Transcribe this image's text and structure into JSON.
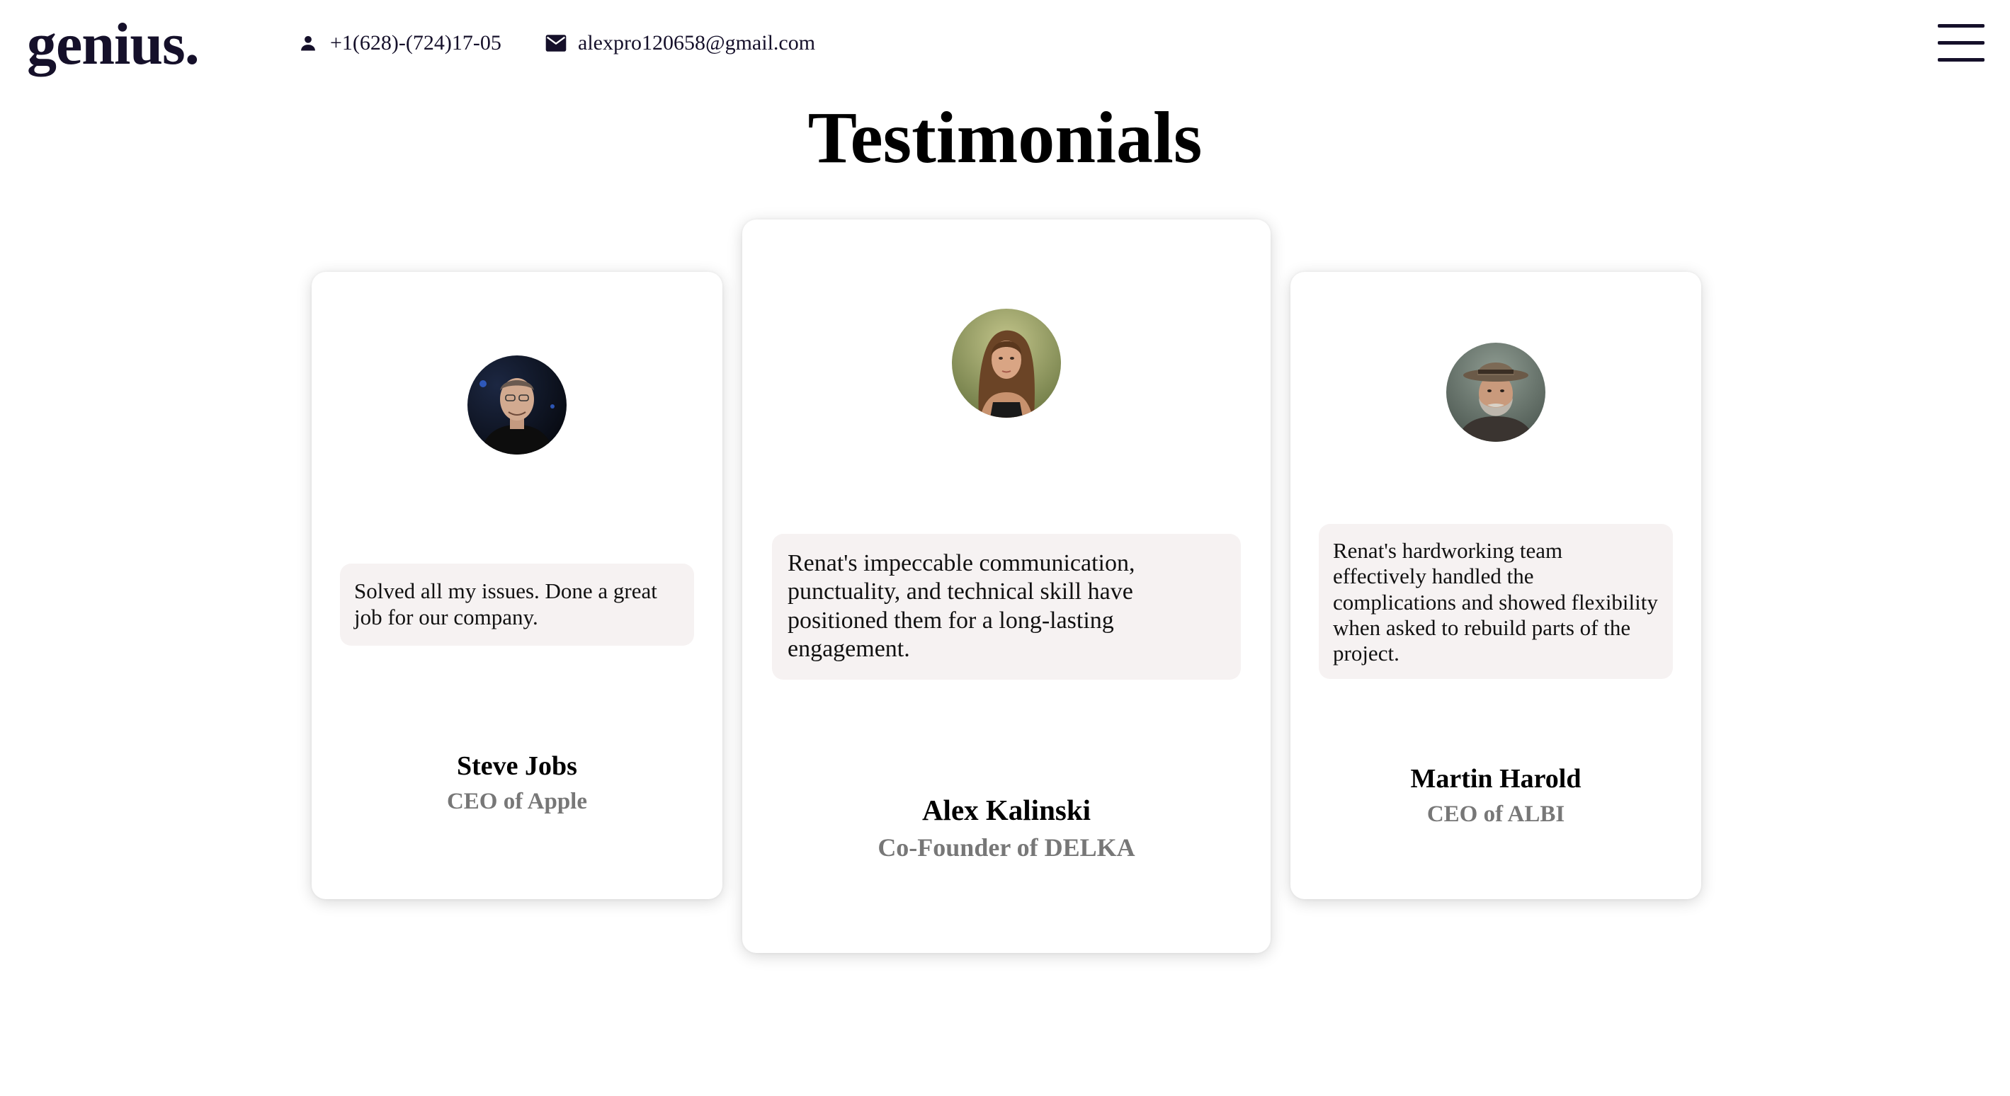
{
  "header": {
    "logo": "genius.",
    "phone": "+1(628)-(724)17-05",
    "email": "alexpro120658@gmail.com",
    "phone_icon": "person-icon",
    "email_icon": "envelope-icon",
    "menu_icon": "hamburger-menu-icon"
  },
  "section": {
    "title": "Testimonials"
  },
  "testimonials": [
    {
      "quote": "Solved all my issues. Done a great job for our company.",
      "name": "Steve Jobs",
      "role": "CEO of Apple"
    },
    {
      "quote": "Renat's impeccable communication, punctuality, and technical skill have positioned them for a long-lasting engagement.",
      "name": "Alex Kalinski",
      "role": "Co-Founder of DELKA"
    },
    {
      "quote": "Renat's hardworking team effectively handled the complications and showed flexibility when asked to rebuild parts of the project.",
      "name": "Martin Harold",
      "role": "CEO of ALBI"
    }
  ],
  "colors": {
    "brand": "#15102a",
    "quote_bg": "#f6f2f2",
    "role_text": "#777777",
    "background": "#ffffff"
  }
}
